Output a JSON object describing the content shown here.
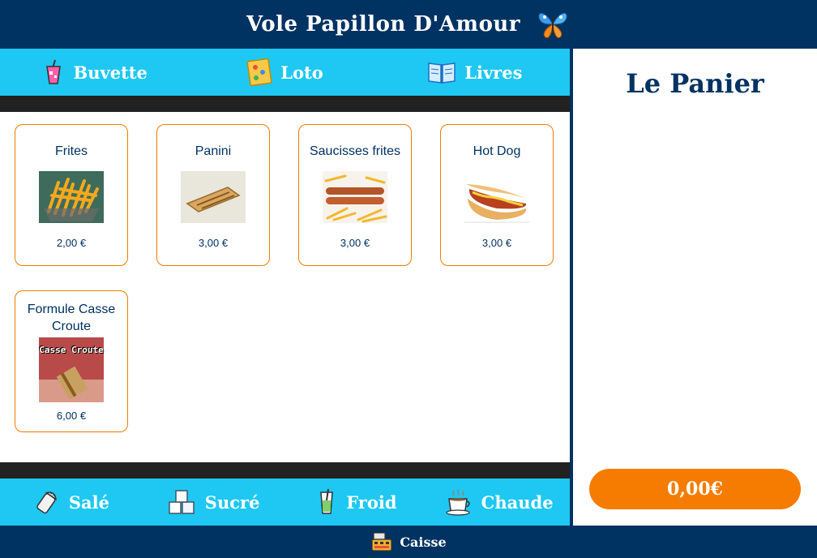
{
  "header": {
    "title": "Vole Papillon D'Amour",
    "logo_icon": "butterfly-icon"
  },
  "top_nav": [
    {
      "label": "Buvette",
      "icon": "drink-icon"
    },
    {
      "label": "Loto",
      "icon": "loto-card-icon"
    },
    {
      "label": "Livres",
      "icon": "book-icon"
    }
  ],
  "products": [
    {
      "name": "Frites",
      "price": "2,00 €",
      "image": "fries-image"
    },
    {
      "name": "Panini",
      "price": "3,00 €",
      "image": "panini-image"
    },
    {
      "name": "Saucisses frites",
      "price": "3,00 €",
      "image": "sausages-fries-image"
    },
    {
      "name": "Hot Dog",
      "price": "3,00 €",
      "image": "hot-dog-image"
    },
    {
      "name": "Formule Casse Croute",
      "price": "6,00 €",
      "image": "casse-croute-image",
      "image_text": "Casse Croute"
    }
  ],
  "bottom_nav": [
    {
      "label": "Salé",
      "icon": "salt-shaker-icon"
    },
    {
      "label": "Sucré",
      "icon": "sugar-cubes-icon"
    },
    {
      "label": "Froid",
      "icon": "cold-drink-icon"
    },
    {
      "label": "Chaude",
      "icon": "hot-cup-icon"
    }
  ],
  "cart": {
    "title": "Le Panier",
    "total": "0,00€"
  },
  "footer": {
    "label": "Caisse",
    "icon": "cash-register-icon"
  },
  "colors": {
    "navy": "#003262",
    "cyan": "#1ec8f2",
    "orange": "#f57c00",
    "card_border": "#f07c00",
    "dark_band": "#222222"
  }
}
